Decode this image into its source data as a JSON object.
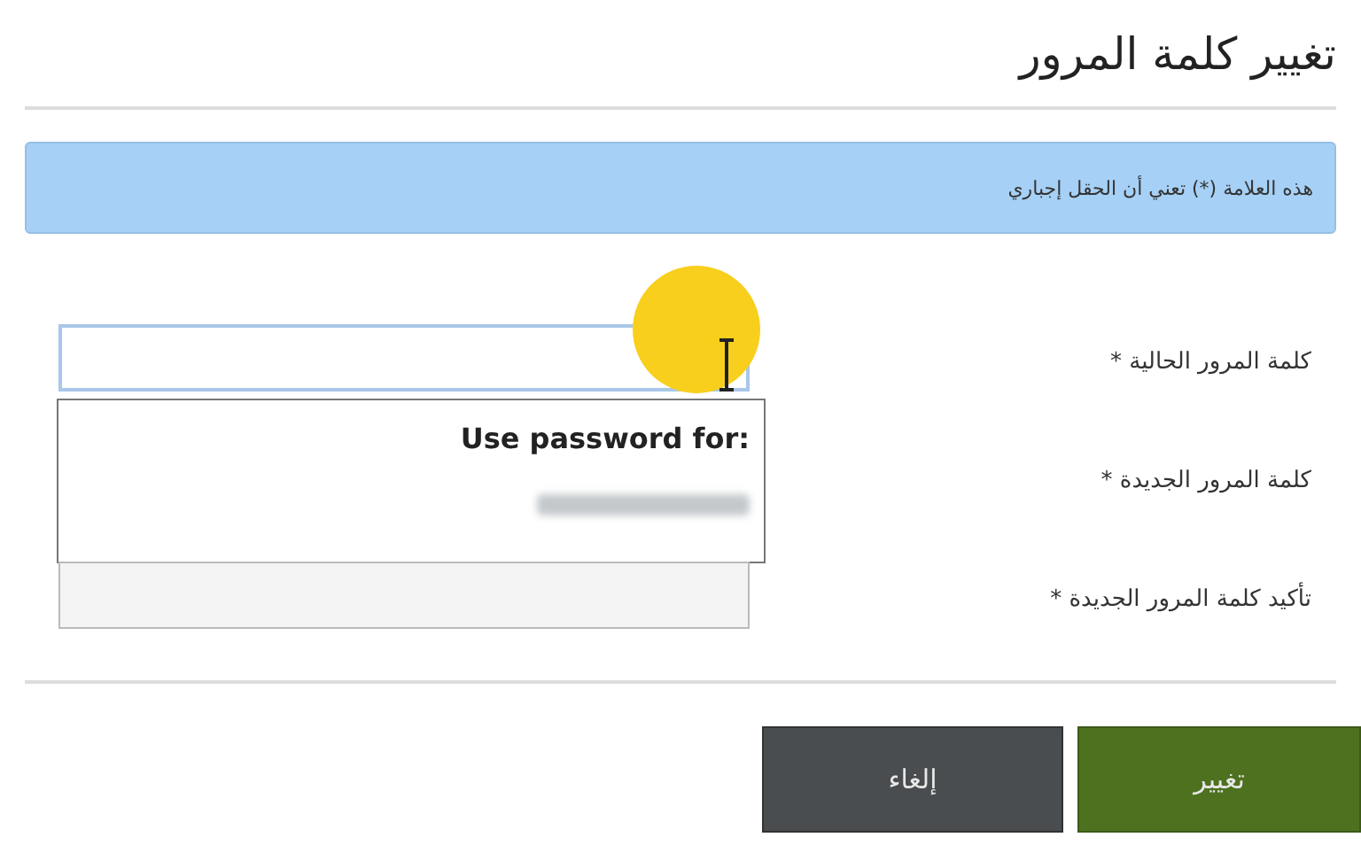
{
  "title": "تغيير كلمة المرور",
  "notice": "هذه العلامة (*) تعني أن الحقل إجباري",
  "fields": [
    {
      "label": "كلمة المرور الحالية *",
      "focused": true,
      "covered": false
    },
    {
      "label": "كلمة المرور الجديدة *",
      "focused": false,
      "covered": true
    },
    {
      "label": "تأكيد كلمة المرور الجديدة *",
      "focused": false,
      "covered": false
    }
  ],
  "autofill": {
    "heading": "Use password for:"
  },
  "buttons": [
    {
      "label": "تغيير",
      "kind": "primary"
    },
    {
      "label": "إلغاء",
      "kind": "secondary"
    }
  ]
}
